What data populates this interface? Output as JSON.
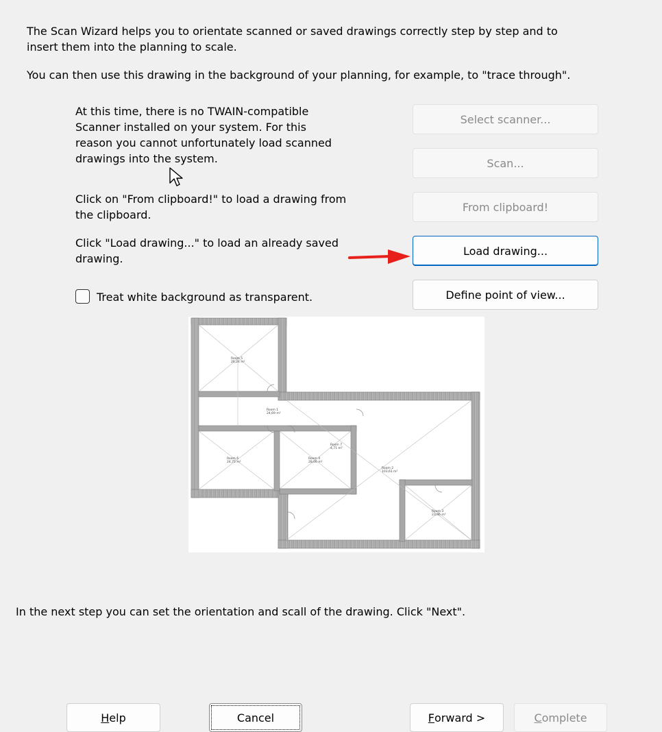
{
  "intro": {
    "line1": "The Scan Wizard helps you to orientate scanned or saved drawings correctly step by step and to",
    "line2": "insert them into the planning to scale.",
    "line3": "You can then use this drawing in the background of your planning, for example, to \"trace through\"."
  },
  "instructions": {
    "twain_line1": "At this time, there is no TWAIN-compatible",
    "twain_line2": "Scanner installed on your system. For this",
    "twain_line3": "reason you cannot unfortunately load scanned",
    "twain_line4": "drawings into the system.",
    "clipboard_line1": "Click on \"From clipboard!\" to load a drawing from",
    "clipboard_line2": "the clipboard.",
    "load_line1": "Click \"Load drawing...\" to load an already saved",
    "load_line2": "drawing."
  },
  "buttons": {
    "select_scanner": "Select scanner...",
    "scan": "Scan...",
    "from_clipboard": "From clipboard!",
    "load_drawing": "Load drawing...",
    "define_point_of_view": "Define point of view..."
  },
  "checkbox": {
    "label": "Treat white background as transparent.",
    "checked": false
  },
  "floor_plan": {
    "rooms": [
      {
        "name": "Room 5",
        "area": "26,24 m²"
      },
      {
        "name": "Room 1",
        "area": "24,69 m²"
      },
      {
        "name": "Room 6",
        "area": "24,75 m²"
      },
      {
        "name": "Room 4",
        "area": "28,06 m²"
      },
      {
        "name": "Room 7",
        "area": "4,71 m²"
      },
      {
        "name": "Room 2",
        "area": "103,61 m²"
      },
      {
        "name": "Room 3",
        "area": "23,96 m²"
      }
    ]
  },
  "next_step": "In the next step you can set the orientation and scall of the drawing. Click \"Next\".",
  "footer": {
    "help_prefix": "",
    "help_mnemonic": "H",
    "help_rest": "elp",
    "cancel": "Cancel",
    "forward_mnemonic": "F",
    "forward_rest": "orward >",
    "complete_mnemonic": "C",
    "complete_rest": "omplete"
  },
  "colors": {
    "background": "#f0f0f0",
    "accent": "#0067c0",
    "arrow": "#e8201c",
    "wall": "#a8a8a8"
  }
}
